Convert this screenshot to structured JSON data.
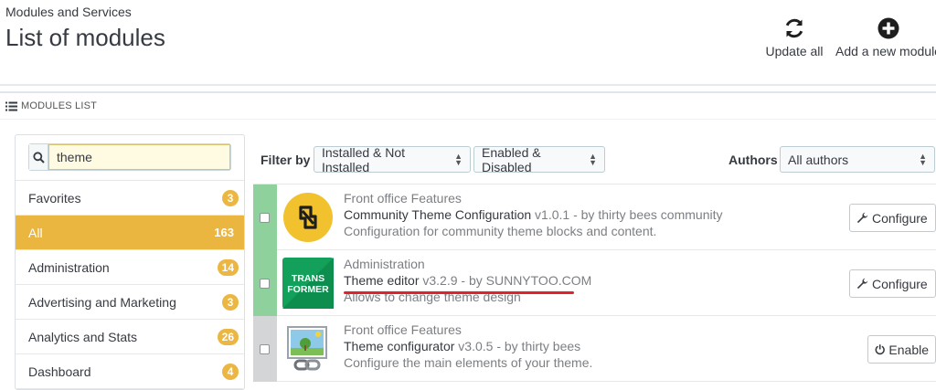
{
  "header": {
    "breadcrumb": "Modules and Services",
    "title": "List of modules",
    "update_all_label": "Update all",
    "add_module_label": "Add a new module"
  },
  "panel": {
    "heading": "MODULES LIST"
  },
  "search": {
    "value": "theme",
    "placeholder": ""
  },
  "categories": [
    {
      "label": "Favorites",
      "count": "3",
      "active": false
    },
    {
      "label": "All",
      "count": "163",
      "active": true
    },
    {
      "label": "Administration",
      "count": "14",
      "active": false
    },
    {
      "label": "Advertising and Marketing",
      "count": "3",
      "active": false
    },
    {
      "label": "Analytics and Stats",
      "count": "26",
      "active": false
    },
    {
      "label": "Dashboard",
      "count": "4",
      "active": false
    }
  ],
  "filters": {
    "label": "Filter by",
    "install_filter": "Installed & Not Installed",
    "enable_filter": "Enabled & Disabled",
    "authors_label": "Authors",
    "authors_filter": "All authors"
  },
  "modules": [
    {
      "category": "Front office Features",
      "name": "Community Theme Configuration",
      "version_author": " v1.0.1 - by thirty bees community",
      "description": "Configuration for community theme blocks and content.",
      "action": "Configure",
      "status": "enabled",
      "logo_icon": "thirty-bees-logo-icon"
    },
    {
      "category": "Administration",
      "name": "Theme editor",
      "version_author": " v3.2.9 - by SUNNYTOO.COM",
      "description": "Allows to change theme design",
      "action": "Configure",
      "status": "enabled",
      "logo_icon": "transformer-logo-icon",
      "logo_text_1": "TRANS",
      "logo_text_2": "FORMER"
    },
    {
      "category": "Front office Features",
      "name": "Theme configurator",
      "version_author": " v3.0.5 - by thirty bees",
      "description": "Configure the main elements of your theme.",
      "action": "Enable",
      "status": "disabled",
      "logo_icon": "picture-chain-icon"
    }
  ],
  "colors": {
    "accent": "#eab640",
    "enabled": "#8fd19c",
    "disabled": "#d3d5d7",
    "highlight": "#e0232b"
  }
}
